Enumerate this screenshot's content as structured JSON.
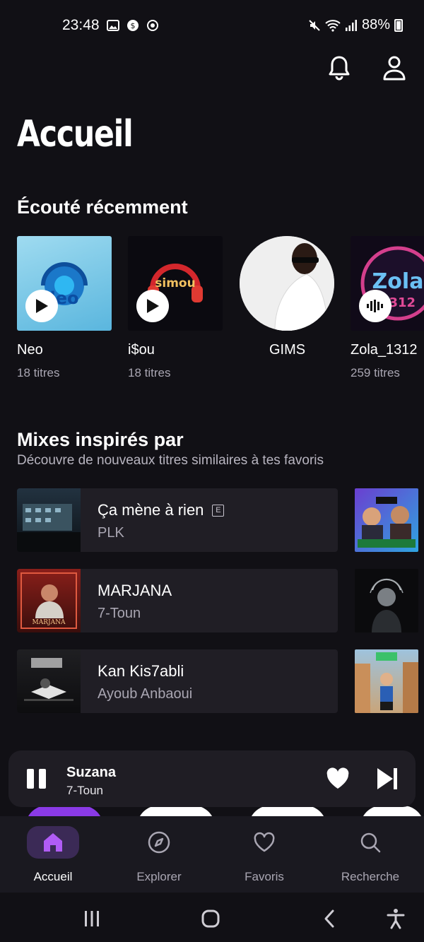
{
  "status_bar": {
    "time": "23:48",
    "battery": "88%"
  },
  "header": {
    "title": "Accueil"
  },
  "recent": {
    "title": "Écouté récemment",
    "items": [
      {
        "name": "Neo",
        "count": "18 titres"
      },
      {
        "name": "i$ou",
        "count": "18 titres"
      },
      {
        "name": "GIMS",
        "count": ""
      },
      {
        "name": "Zola_1312",
        "count": "259 titres"
      }
    ]
  },
  "mixes": {
    "title": "Mixes inspirés par",
    "subtitle": "Découvre de nouveaux titres similaires à tes favoris",
    "items": [
      {
        "title": "Ça mène à rien",
        "artist": "PLK",
        "explicit": "E"
      },
      {
        "title": "MARJANA",
        "artist": "7-Toun"
      },
      {
        "title": "Kan Kis7abli",
        "artist": "Ayoub Anbaoui"
      }
    ]
  },
  "player": {
    "title": "Suzana",
    "artist": "7-Toun"
  },
  "nav": {
    "items": [
      {
        "label": "Accueil",
        "icon": "home-icon",
        "active": true
      },
      {
        "label": "Explorer",
        "icon": "compass-icon"
      },
      {
        "label": "Favoris",
        "icon": "heart-icon"
      },
      {
        "label": "Recherche",
        "icon": "search-icon"
      }
    ]
  },
  "colors": {
    "accent": "#a55cf0",
    "background": "#111015",
    "card": "#201e25"
  }
}
